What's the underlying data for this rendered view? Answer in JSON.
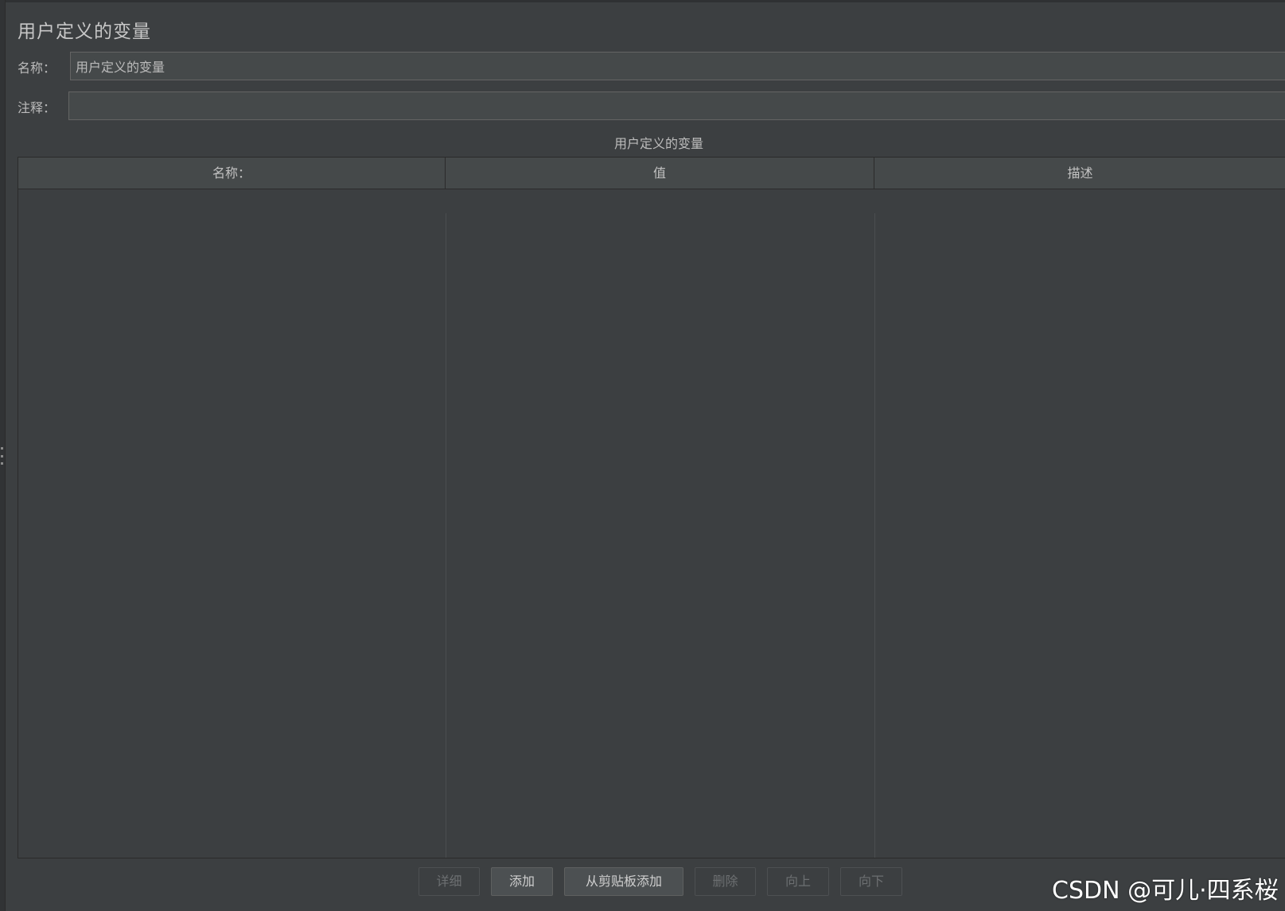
{
  "panel": {
    "title": "用户定义的变量"
  },
  "form": {
    "name_label": "名称：",
    "name_value": "用户定义的变量",
    "comment_label": "注释：",
    "comment_value": ""
  },
  "table": {
    "caption": "用户定义的变量",
    "columns": [
      "名称：",
      "值",
      "描述"
    ],
    "rows": []
  },
  "buttons": {
    "detail": "详细",
    "add": "添加",
    "add_from_clipboard": "从剪贴板添加",
    "delete": "删除",
    "up": "向上",
    "down": "向下"
  },
  "watermark": "CSDN @可儿·四系桜"
}
